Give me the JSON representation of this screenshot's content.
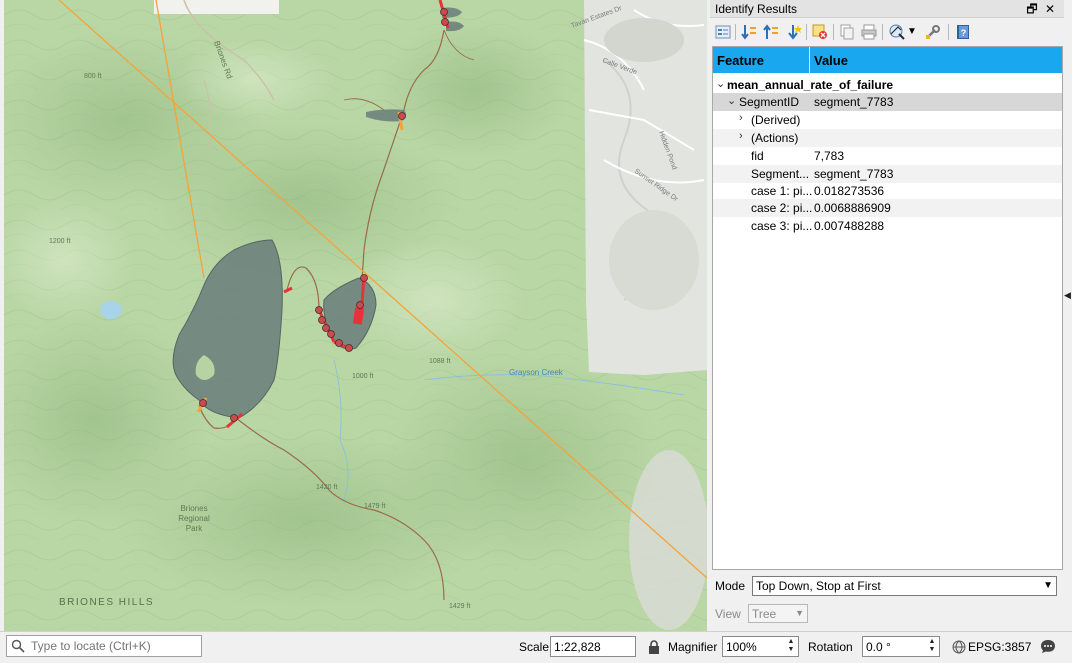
{
  "map": {
    "labels": {
      "briones_rd": "Briones Rd",
      "park": [
        "Briones",
        "Regional",
        "Park"
      ],
      "hills": "BRIONES HILLS",
      "creek": "Grayson Creek",
      "elev_1088": "1088 ft",
      "elev_1420": "1420 ft",
      "elev_1479": "1479 ft",
      "elev_1429": "1429 ft",
      "elev_1200": "1200 ft",
      "elev_1000": "1000 ft",
      "elev_800": "800 ft",
      "tavan": "Tavan Estates Dr",
      "calle_verde": "Calle Verde",
      "sunset_ridge": "Sunset Ridge Dr",
      "hidden_pond": "Hidden Pond"
    }
  },
  "panel": {
    "title": "Identify Results",
    "restore_icon": "restore-icon",
    "close_icon": "close-icon",
    "table": {
      "col_feature": "Feature",
      "col_value": "Value",
      "layer": "mean_annual_rate_of_failure",
      "root_key": "SegmentID",
      "root_value": "segment_7783",
      "derived": "(Derived)",
      "actions": "(Actions)",
      "attributes": [
        {
          "key": "fid",
          "value": "7,783"
        },
        {
          "key": "Segment...",
          "value": "segment_7783"
        },
        {
          "key": "case 1: pi...",
          "value": "0.018273536"
        },
        {
          "key": "case 2: pi...",
          "value": "0.0068886909"
        },
        {
          "key": "case 3: pi...",
          "value": "0.007488288"
        }
      ]
    },
    "mode_label": "Mode",
    "mode_value": "Top Down, Stop at First",
    "view_label": "View",
    "view_value": "Tree"
  },
  "status": {
    "locate_placeholder": "Type to locate (Ctrl+K)",
    "scale_label": "Scale",
    "scale_value": "1:22,828",
    "magnifier_label": "Magnifier",
    "magnifier_value": "100%",
    "rotation_label": "Rotation",
    "rotation_value": "0.0 °",
    "crs": "EPSG:3857"
  },
  "colors": {
    "accent_header": "#19a7ef",
    "polygon_fill": "#6b7f7c",
    "failure_segment": "#e8323a",
    "power_line": "#f5a33a"
  }
}
